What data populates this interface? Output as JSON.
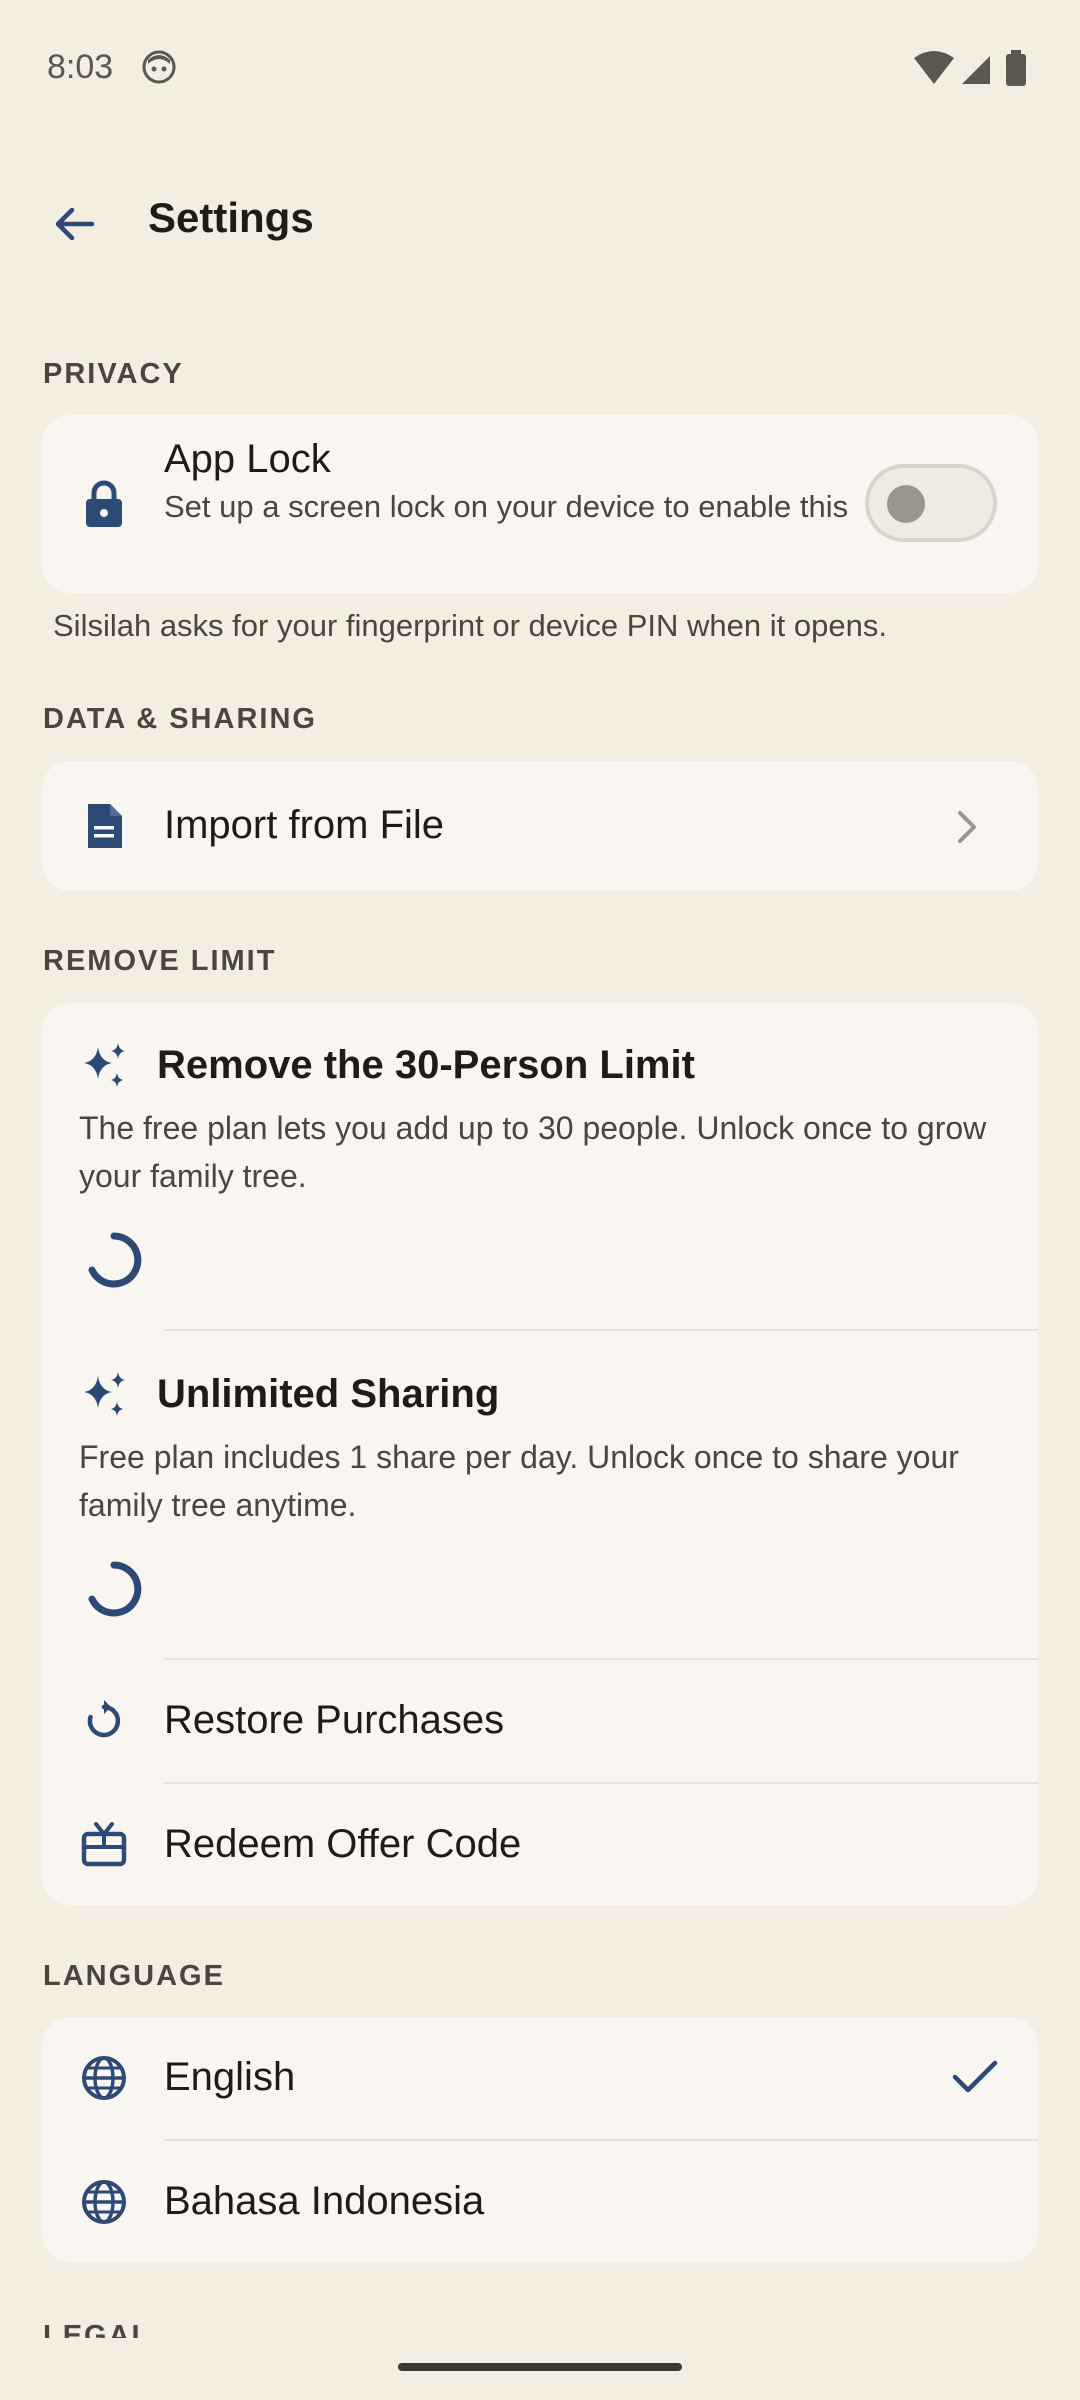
{
  "status_bar": {
    "time": "8:03"
  },
  "header": {
    "title": "Settings"
  },
  "privacy": {
    "section_label": "PRIVACY",
    "app_lock": {
      "title": "App Lock",
      "subtitle": "Set up a screen lock on your device to enable this",
      "enabled": false
    },
    "helper": "Silsilah asks for your fingerprint or device PIN when it opens."
  },
  "data_sharing": {
    "section_label": "DATA & SHARING",
    "import_label": "Import from File"
  },
  "remove_limit": {
    "section_label": "REMOVE LIMIT",
    "features": [
      {
        "title": "Remove the 30-Person Limit",
        "description": "The free plan lets you add up to 30 people. Unlock once to grow your family tree."
      },
      {
        "title": "Unlimited Sharing",
        "description": "Free plan includes 1 share per day. Unlock once to share your family tree anytime."
      }
    ],
    "restore_label": "Restore Purchases",
    "redeem_label": "Redeem Offer Code"
  },
  "language": {
    "section_label": "LANGUAGE",
    "options": [
      {
        "label": "English",
        "selected": true
      },
      {
        "label": "Bahasa Indonesia",
        "selected": false
      }
    ]
  },
  "legal": {
    "section_label": "LEGAL"
  },
  "colors": {
    "background": "#f3ede2",
    "card": "#f9f6f1",
    "accent": "#2c4a75"
  }
}
